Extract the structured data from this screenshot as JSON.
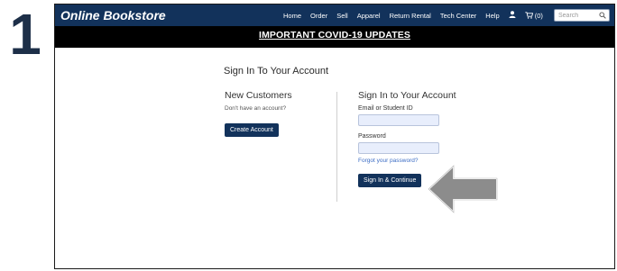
{
  "step": {
    "number": "1"
  },
  "header": {
    "brand": "Online Bookstore",
    "nav": [
      "Home",
      "Order",
      "Sell",
      "Apparel",
      "Return Rental",
      "Tech Center",
      "Help"
    ],
    "cart_count": "(0)",
    "search_placeholder": "Search"
  },
  "banner": {
    "text": "IMPORTANT COVID-19 UPDATES"
  },
  "signin": {
    "page_title": "Sign In To Your Account",
    "new_customers": {
      "heading": "New Customers",
      "text": "Don't have an account?",
      "button": "Create Account"
    },
    "account": {
      "heading": "Sign In to Your Account",
      "email_label": "Email or Student ID",
      "password_label": "Password",
      "forgot": "Forgot your password?",
      "button": "Sign In & Continue"
    }
  },
  "colors": {
    "nav_bg": "#12325b",
    "banner_bg": "#000000",
    "button_bg": "#12325b",
    "input_bg": "#e8eefc",
    "link": "#3b6cc4",
    "arrow": "#8c8c8c"
  },
  "icons": [
    "user-icon",
    "cart-icon",
    "search-icon",
    "pointer-arrow-icon"
  ]
}
